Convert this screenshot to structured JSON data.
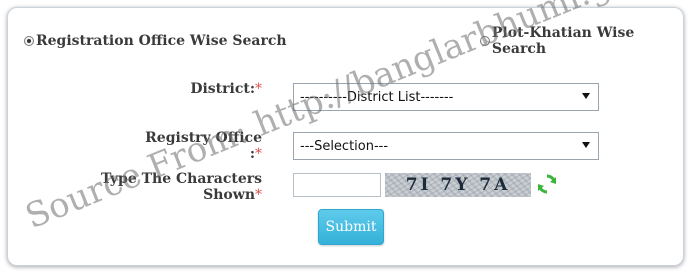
{
  "search_mode": {
    "option1_label": "Registration Office Wise Search",
    "option1_selected": true,
    "option2_label": "Plot-Khatian Wise Search",
    "option2_selected": false
  },
  "form": {
    "district_label": "District:",
    "district_value": "----------District List-------",
    "registry_label": "Registry Office :",
    "registry_value": "---Selection---",
    "captcha_label": "Type The Characters Shown",
    "required_mark": "*",
    "captcha_input_value": "",
    "captcha_text": "7I 7Y 7A",
    "submit_label": "Submit"
  },
  "watermark": {
    "text": "Source From: http://banglarbhumi.gov.in"
  },
  "colors": {
    "required": "#d9534f",
    "submit_bg": "#34b1d9",
    "refresh_icon": "#3cb53c"
  }
}
